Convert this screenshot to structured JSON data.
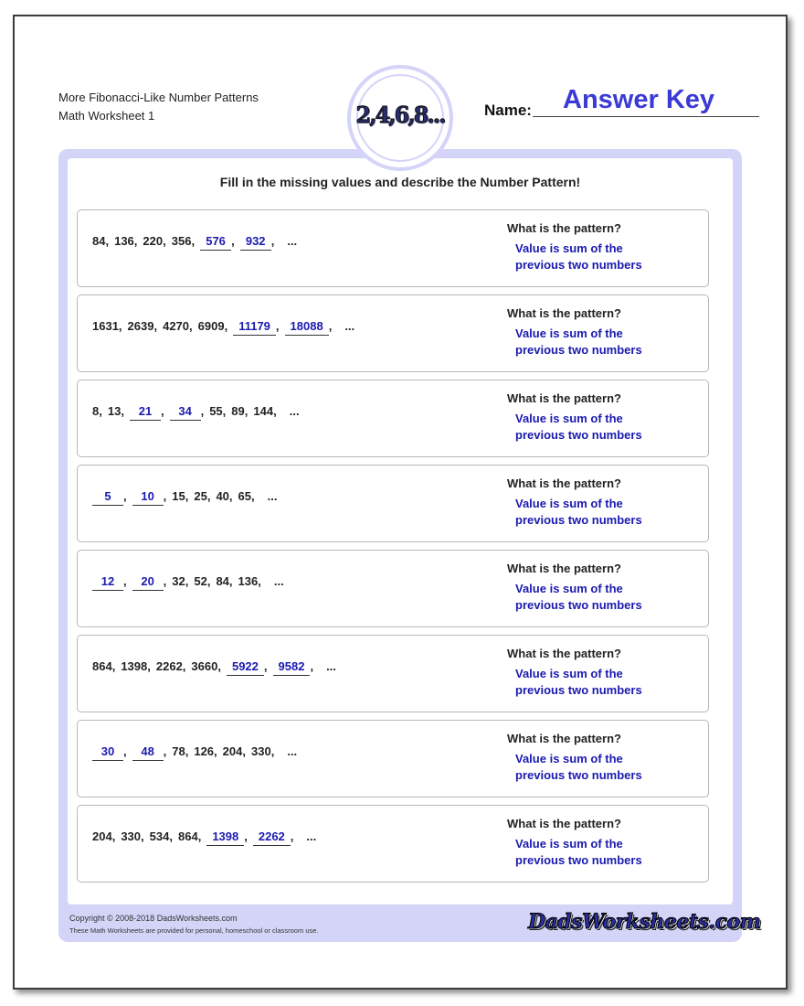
{
  "header": {
    "title": "More Fibonacci-Like Number Patterns",
    "subtitle": "Math Worksheet 1",
    "emblem_text": "2,4,6,8...",
    "name_label": "Name:",
    "name_value": "Answer Key"
  },
  "instructions": "Fill in the missing values and describe the Number Pattern!",
  "question_label": "What is the pattern?",
  "problems": [
    {
      "terms": [
        {
          "v": "84"
        },
        {
          "v": "136"
        },
        {
          "v": "220"
        },
        {
          "v": "356"
        },
        {
          "v": "576",
          "blank": true
        },
        {
          "v": "932",
          "blank": true
        }
      ],
      "answer_line1": "Value is sum of the",
      "answer_line2": "previous two numbers"
    },
    {
      "terms": [
        {
          "v": "1631"
        },
        {
          "v": "2639"
        },
        {
          "v": "4270"
        },
        {
          "v": "6909"
        },
        {
          "v": "11179",
          "blank": true
        },
        {
          "v": "18088",
          "blank": true
        }
      ],
      "answer_line1": "Value is sum of the",
      "answer_line2": "previous two numbers"
    },
    {
      "terms": [
        {
          "v": "8"
        },
        {
          "v": "13"
        },
        {
          "v": "21",
          "blank": true
        },
        {
          "v": "34",
          "blank": true
        },
        {
          "v": "55"
        },
        {
          "v": "89"
        },
        {
          "v": "144"
        }
      ],
      "answer_line1": "Value is sum of the",
      "answer_line2": "previous two numbers"
    },
    {
      "terms": [
        {
          "v": "5",
          "blank": true
        },
        {
          "v": "10",
          "blank": true
        },
        {
          "v": "15"
        },
        {
          "v": "25"
        },
        {
          "v": "40"
        },
        {
          "v": "65"
        }
      ],
      "answer_line1": "Value is sum of the",
      "answer_line2": "previous two numbers"
    },
    {
      "terms": [
        {
          "v": "12",
          "blank": true
        },
        {
          "v": "20",
          "blank": true
        },
        {
          "v": "32"
        },
        {
          "v": "52"
        },
        {
          "v": "84"
        },
        {
          "v": "136"
        }
      ],
      "answer_line1": "Value is sum of the",
      "answer_line2": "previous two numbers"
    },
    {
      "terms": [
        {
          "v": "864"
        },
        {
          "v": "1398"
        },
        {
          "v": "2262"
        },
        {
          "v": "3660"
        },
        {
          "v": "5922",
          "blank": true
        },
        {
          "v": "9582",
          "blank": true
        }
      ],
      "answer_line1": "Value is sum of the",
      "answer_line2": "previous two numbers"
    },
    {
      "terms": [
        {
          "v": "30",
          "blank": true
        },
        {
          "v": "48",
          "blank": true
        },
        {
          "v": "78"
        },
        {
          "v": "126"
        },
        {
          "v": "204"
        },
        {
          "v": "330"
        }
      ],
      "answer_line1": "Value is sum of the",
      "answer_line2": "previous two numbers"
    },
    {
      "terms": [
        {
          "v": "204"
        },
        {
          "v": "330"
        },
        {
          "v": "534"
        },
        {
          "v": "864"
        },
        {
          "v": "1398",
          "blank": true
        },
        {
          "v": "2262",
          "blank": true
        }
      ],
      "answer_line1": "Value is sum of the",
      "answer_line2": "previous two numbers"
    }
  ],
  "ellipsis": "...",
  "footer": {
    "copyright": "Copyright © 2008-2018 DadsWorksheets.com",
    "notice": "These Math Worksheets are provided for personal, homeschool or classroom use.",
    "logo_text": "DadsWorksheets.com"
  }
}
